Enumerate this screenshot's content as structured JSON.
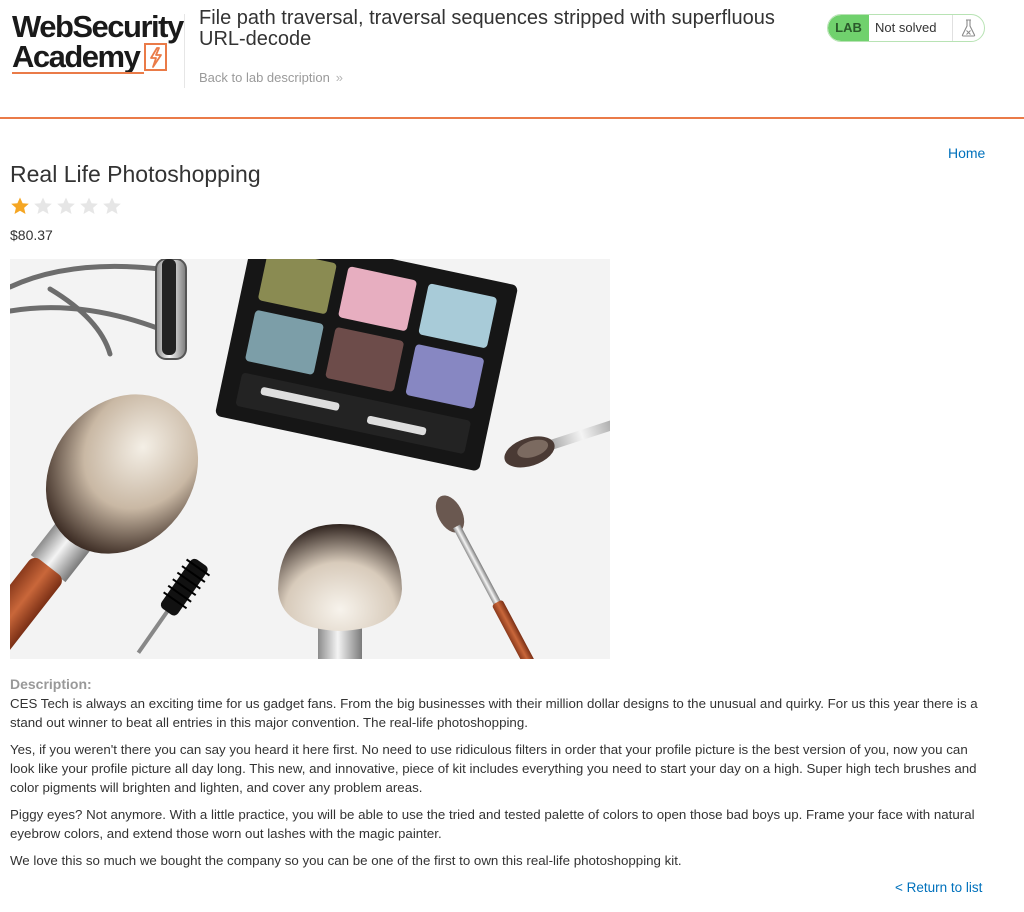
{
  "header": {
    "logo_line1": "WebSecurity",
    "logo_line2": "Academy",
    "lab_title": "File path traversal, traversal sequences stripped with superfluous URL-decode",
    "back_link": "Back to lab description",
    "back_chevron": "»",
    "status": {
      "badge": "LAB",
      "text": "Not solved"
    }
  },
  "nav": {
    "home": "Home"
  },
  "product": {
    "title": "Real Life Photoshopping",
    "rating": 1,
    "rating_max": 5,
    "price": "$80.37",
    "image_alt": "makeup brushes and eyeshadow palette",
    "description_label": "Description:",
    "paragraphs": [
      "CES Tech is always an exciting time for us gadget fans. From the big businesses with their million dollar designs to the unusual and quirky. For us this year there is a stand out winner to beat all entries in this major convention. The real-life photoshopping.",
      "Yes, if you weren't there you can say you heard it here first. No need to use ridiculous filters in order that your profile picture is the best version of you, now you can look like your profile picture all day long. This new, and innovative, piece of kit includes everything you need to start your day on a high. Super high tech brushes and color pigments will brighten and lighten, and cover any problem areas.",
      "Piggy eyes? Not anymore. With a little practice, you will be able to use the tried and tested palette of colors to open those bad boys up. Frame your face with natural eyebrow colors, and extend those worn out lashes with the magic painter.",
      "We love this so much we bought the company so you can be one of the first to own this real-life photoshopping kit."
    ],
    "return_link": "< Return to list"
  },
  "colors": {
    "accent_orange": "#ea7b48",
    "link_blue": "#0071bc",
    "lab_green": "#70d16d",
    "star_filled": "#f5a623",
    "star_empty": "#e6e6e6"
  }
}
